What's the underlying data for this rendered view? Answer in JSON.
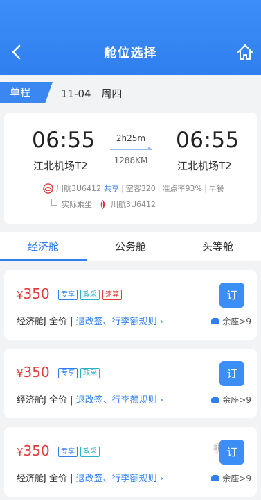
{
  "header": {
    "title": "舱位选择",
    "back_icon": "back-arrow-icon",
    "home_icon": "home-icon",
    "color": "#3d8ef7"
  },
  "trip": {
    "type_label": "单程",
    "date": "11-04",
    "weekday": "周四"
  },
  "flight": {
    "dep_time": "06:55",
    "dep_airport": "江北机场T2",
    "arr_time": "06:55",
    "arr_airport": "江北机场T2",
    "duration": "2h25m",
    "distance": "1288KM",
    "airline": "川航3U6412",
    "shared_label": "共享",
    "aircraft": "空客320",
    "on_time": "准点率93%",
    "meal": "早餐",
    "actual_label": "实际乘坐",
    "actual_airline": "川航3U6412"
  },
  "tabs": [
    {
      "label": "经济舱",
      "active": true
    },
    {
      "label": "公务舱",
      "active": false
    },
    {
      "label": "头等舱",
      "active": false
    }
  ],
  "fares": [
    {
      "currency": "¥",
      "price": "350",
      "tags": [
        "专享",
        "政采",
        "速算"
      ],
      "cabin": "经济舱J 全价",
      "divider": "|",
      "rules": "退改签、行李额规则",
      "book_label": "订",
      "seats": "余座>9"
    },
    {
      "currency": "¥",
      "price": "350",
      "tags": [
        "专享",
        "政采"
      ],
      "cabin": "经济舱J 全价",
      "divider": "|",
      "rules": "退改签、行李额规则",
      "book_label": "订",
      "seats": "余座>9"
    },
    {
      "currency": "¥",
      "price": "350",
      "tags": [
        "专享",
        "政采"
      ],
      "cabin": "经济舱J 全价",
      "divider": "|",
      "rules": "退改签、行李额规则",
      "book_label": "订",
      "seats": "余座>9",
      "overlay_text": "手"
    }
  ]
}
